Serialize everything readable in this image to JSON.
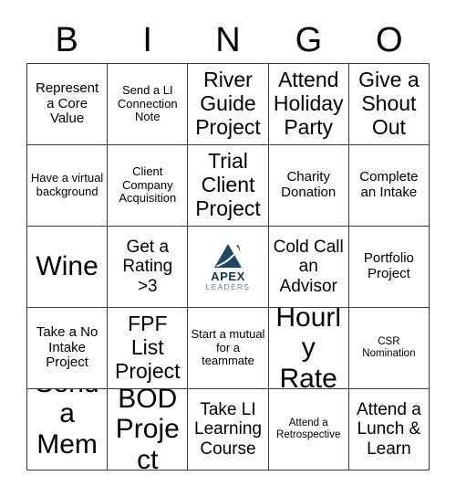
{
  "card": {
    "title": "BINGO",
    "header_letters": [
      "B",
      "I",
      "N",
      "G",
      "O"
    ],
    "border_color": "#3a3a3a",
    "background_color": "#ffffff",
    "text_color": "#000000"
  },
  "logo": {
    "name": "apex-leaders-logo",
    "word": "APEX",
    "sub": "LEADERS",
    "mark_color": "#1b4965",
    "word_color": "#14374f",
    "sub_color": "#5b7f96",
    "swoosh_color": "#ffffff"
  },
  "cells": [
    {
      "text": "Represent a Core Value",
      "size": "fs-sm",
      "type": "text"
    },
    {
      "text": "Send a LI Connection Note",
      "size": "fs-xs",
      "type": "text"
    },
    {
      "text": "River Guide Project",
      "size": "fs-lg",
      "type": "text"
    },
    {
      "text": "Attend Holiday Party",
      "size": "fs-lg",
      "type": "text"
    },
    {
      "text": "Give a Shout Out",
      "size": "fs-lg",
      "type": "text"
    },
    {
      "text": "Have a virtual background",
      "size": "fs-xs",
      "type": "text"
    },
    {
      "text": "Client Company Acquisition",
      "size": "fs-xs",
      "type": "text"
    },
    {
      "text": "Trial Client Project",
      "size": "fs-lg",
      "type": "text"
    },
    {
      "text": "Charity Donation",
      "size": "fs-sm",
      "type": "text"
    },
    {
      "text": "Complete an Intake",
      "size": "fs-sm",
      "type": "text"
    },
    {
      "text": "Wine",
      "size": "fs-xl",
      "type": "text"
    },
    {
      "text": "Get a Rating >3",
      "size": "fs-md",
      "type": "text"
    },
    {
      "text": "",
      "size": "fs-sm",
      "type": "logo"
    },
    {
      "text": "Cold Call an Advisor",
      "size": "fs-md",
      "type": "text"
    },
    {
      "text": "Portfolio Project",
      "size": "fs-sm",
      "type": "text"
    },
    {
      "text": "Take a No Intake Project",
      "size": "fs-sm",
      "type": "text"
    },
    {
      "text": "FPF List Project",
      "size": "fs-lg",
      "type": "text"
    },
    {
      "text": "Start a mutual for a teammate",
      "size": "fs-xs",
      "type": "text"
    },
    {
      "text": "Hourly Rate",
      "size": "fs-xl",
      "type": "text"
    },
    {
      "text": "CSR Nomination",
      "size": "fs-xxs",
      "type": "text"
    },
    {
      "text": "Send a Meme",
      "size": "fs-xl",
      "type": "text"
    },
    {
      "text": "BOD Project",
      "size": "fs-xl",
      "type": "text"
    },
    {
      "text": "Take LI Learning Course",
      "size": "fs-md",
      "type": "text"
    },
    {
      "text": "Attend a Retrospective",
      "size": "fs-xxs",
      "type": "text"
    },
    {
      "text": "Attend a Lunch & Learn",
      "size": "fs-md",
      "type": "text"
    }
  ]
}
